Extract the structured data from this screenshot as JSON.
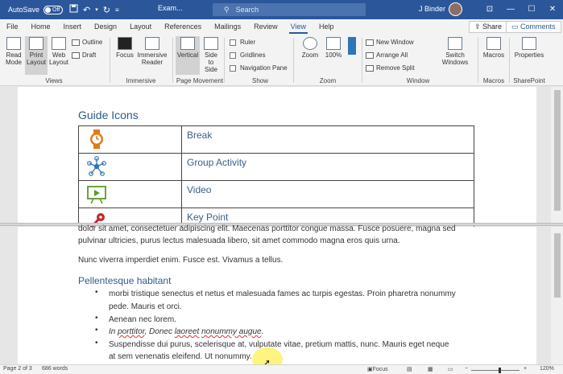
{
  "titlebar": {
    "autosave_label": "AutoSave",
    "autosave_state": "Off",
    "doc_title": "Exam...",
    "search_placeholder": "Search",
    "user_name": "J Binder",
    "qat_icons": [
      "save-icon",
      "undo-icon",
      "redo-icon",
      "customize-qat-icon"
    ]
  },
  "tabs": [
    "File",
    "Home",
    "Insert",
    "Design",
    "Layout",
    "References",
    "Mailings",
    "Review",
    "View",
    "Help"
  ],
  "active_tab": "View",
  "share_label": "Share",
  "comments_label": "Comments",
  "ribbon": {
    "views": {
      "read_mode": "Read Mode",
      "print_layout": "Print Layout",
      "web_layout": "Web Layout",
      "outline": "Outline",
      "draft": "Draft",
      "group": "Views"
    },
    "immersive": {
      "focus": "Focus",
      "immersive_reader": "Immersive Reader",
      "group": "Immersive"
    },
    "page_movement": {
      "vertical": "Vertical",
      "side_to_side": "Side to Side",
      "group": "Page Movement"
    },
    "show": {
      "ruler": "Ruler",
      "gridlines": "Gridlines",
      "navigation_pane": "Navigation Pane",
      "group": "Show"
    },
    "zoom": {
      "zoom": "Zoom",
      "hundred": "100%",
      "group": "Zoom"
    },
    "window": {
      "new_window": "New Window",
      "arrange_all": "Arrange All",
      "remove_split": "Remove Split",
      "switch_windows": "Switch Windows",
      "group": "Window"
    },
    "macros": {
      "macros": "Macros",
      "group": "Macros"
    },
    "sharepoint": {
      "properties": "Properties",
      "group": "SharePoint"
    }
  },
  "document": {
    "guide_heading": "Guide Icons",
    "guide_rows": [
      {
        "icon": "clock-icon",
        "label": "Break"
      },
      {
        "icon": "network-icon",
        "label": "Group Activity"
      },
      {
        "icon": "video-icon",
        "label": "Video"
      },
      {
        "icon": "key-icon",
        "label": "Key Point"
      }
    ],
    "para1_line1": "dolor sit amet, consectetuer adipiscing elit. Maecenas porttitor congue massa. Fusce posuere, magna sed",
    "para1_line2": "pulvinar ultricies, purus lectus malesuada libero, sit amet commodo magna eros quis urna.",
    "para2": "Nunc viverra imperdiet enim. Fusce est. Vivamus a tellus.",
    "subheading": "Pellentesque habitant",
    "bullets": [
      {
        "line1": "morbi tristique senectus et netus et malesuada fames ac turpis egestas. Proin pharetra nonummy",
        "line2": "pede. Mauris et orci."
      },
      {
        "line1": "Aenean nec lorem."
      },
      {
        "pre": "In ",
        "w1": "porttitor",
        "mid": ", Donec ",
        "w2": "laoreet",
        "sp": " ",
        "w3": "nonummy augue",
        "end": "."
      },
      {
        "line1": "Suspendisse dui purus, scelerisque at, vulputate vitae, pretium mattis, nunc. Mauris eget neque",
        "line2": "at sem venenatis eleifend. Ut nonummy."
      }
    ]
  },
  "statusbar": {
    "page": "Page 2 of 3",
    "words": "686 words",
    "focus": "Focus",
    "zoom": "120%",
    "zoom_minus": "−",
    "zoom_plus": "+"
  },
  "colors": {
    "accent": "#2b579a",
    "heading": "#2e5b8a",
    "icon_orange": "#e07b1a",
    "icon_blue": "#2f74b5",
    "icon_green": "#5a9a2a",
    "icon_red": "#c0282b"
  }
}
